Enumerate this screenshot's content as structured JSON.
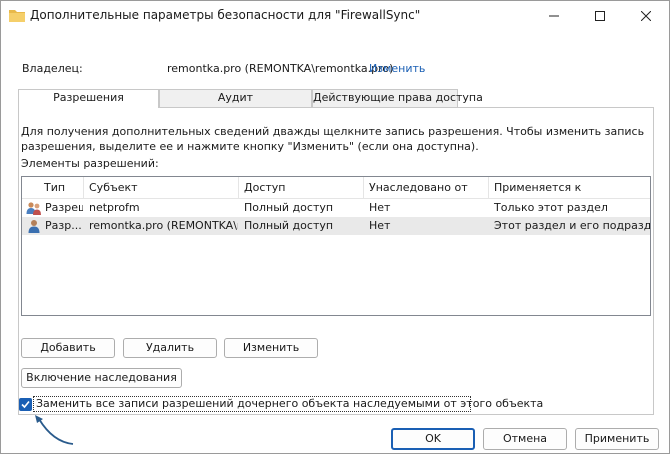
{
  "window": {
    "title": "Дополнительные параметры безопасности  для \"FirewallSync\"",
    "folder_color": "#e8b94a"
  },
  "owner": {
    "label": "Владелец:",
    "value": "remontka.pro (REMONTKA\\remontka.pro)",
    "change_link": "Изменить"
  },
  "tabs": [
    {
      "label": "Разрешения",
      "active": true
    },
    {
      "label": "Аудит",
      "active": false
    },
    {
      "label": "Действующие права доступа",
      "active": false
    }
  ],
  "permissions": {
    "description": "Для получения дополнительных сведений дважды щелкните запись разрешения. Чтобы изменить запись разрешения, выделите ее и нажмите кнопку \"Изменить\" (если она доступна).",
    "list_label": "Элементы разрешений:",
    "columns": [
      "Тип",
      "Субъект",
      "Доступ",
      "Унаследовано от",
      "Применяется к"
    ],
    "rows": [
      {
        "type": "Разреш...",
        "subject": "netprofm",
        "access": "Полный доступ",
        "inherited": "Нет",
        "applies": "Только этот раздел",
        "icon": "group-users-icon"
      },
      {
        "type": "Разр...",
        "subject": "remontka.pro (REMONTKA\\re...",
        "access": "Полный доступ",
        "inherited": "Нет",
        "applies": "Этот раздел и его подразделы",
        "icon": "user-icon"
      }
    ],
    "add_button": "Добавить",
    "remove_button": "Удалить",
    "edit_button": "Изменить",
    "inheritance_button": "Включение наследования",
    "replace_checkbox": {
      "label": "Заменить все записи разрешений дочернего объекта наследуемыми от этого объекта",
      "checked": true
    }
  },
  "footer": {
    "ok": "OK",
    "cancel": "Отмена",
    "apply": "Применить"
  },
  "colors": {
    "accent": "#1a5fb4"
  }
}
